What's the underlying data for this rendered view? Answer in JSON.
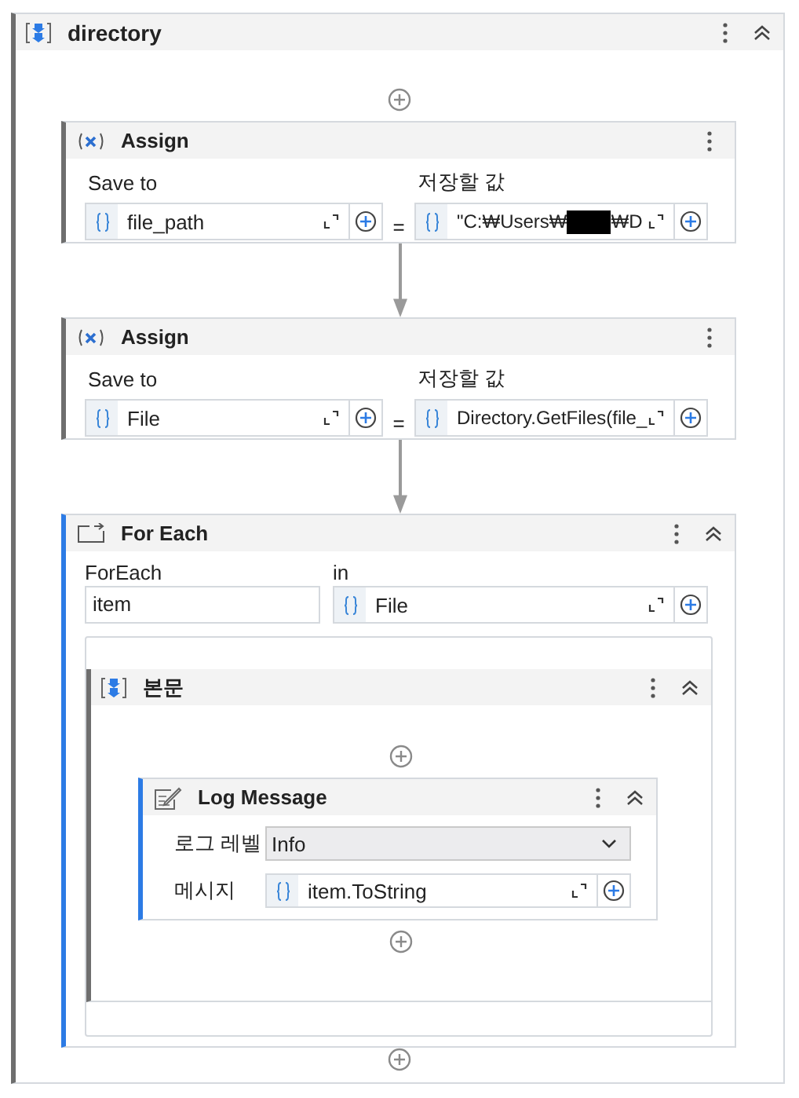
{
  "sequence": {
    "title": "directory"
  },
  "activities": [
    {
      "kind": "assign",
      "title": "Assign",
      "selected": false,
      "to_label": "Save to",
      "to_value": "file_path",
      "operator": "=",
      "value_label": "저장할 값",
      "value_parts": [
        "\"C:₩Users₩",
        "₩D"
      ]
    },
    {
      "kind": "assign",
      "title": "Assign",
      "selected": false,
      "to_label": "Save to",
      "to_value": "File",
      "operator": "=",
      "value_label": "저장할 값",
      "value_parts": [
        "Directory.GetFiles(file_"
      ]
    },
    {
      "kind": "foreach",
      "title": "For Each",
      "selected": true,
      "item_label": "ForEach",
      "item_value": "item",
      "in_label": "in",
      "in_value": "File",
      "body": {
        "title": "본문",
        "activities": [
          {
            "kind": "log",
            "title": "Log Message",
            "selected": true,
            "level_label": "로그 레벨",
            "level_value": "Info",
            "message_label": "메시지",
            "message_value": "item.ToString"
          }
        ]
      }
    }
  ]
}
